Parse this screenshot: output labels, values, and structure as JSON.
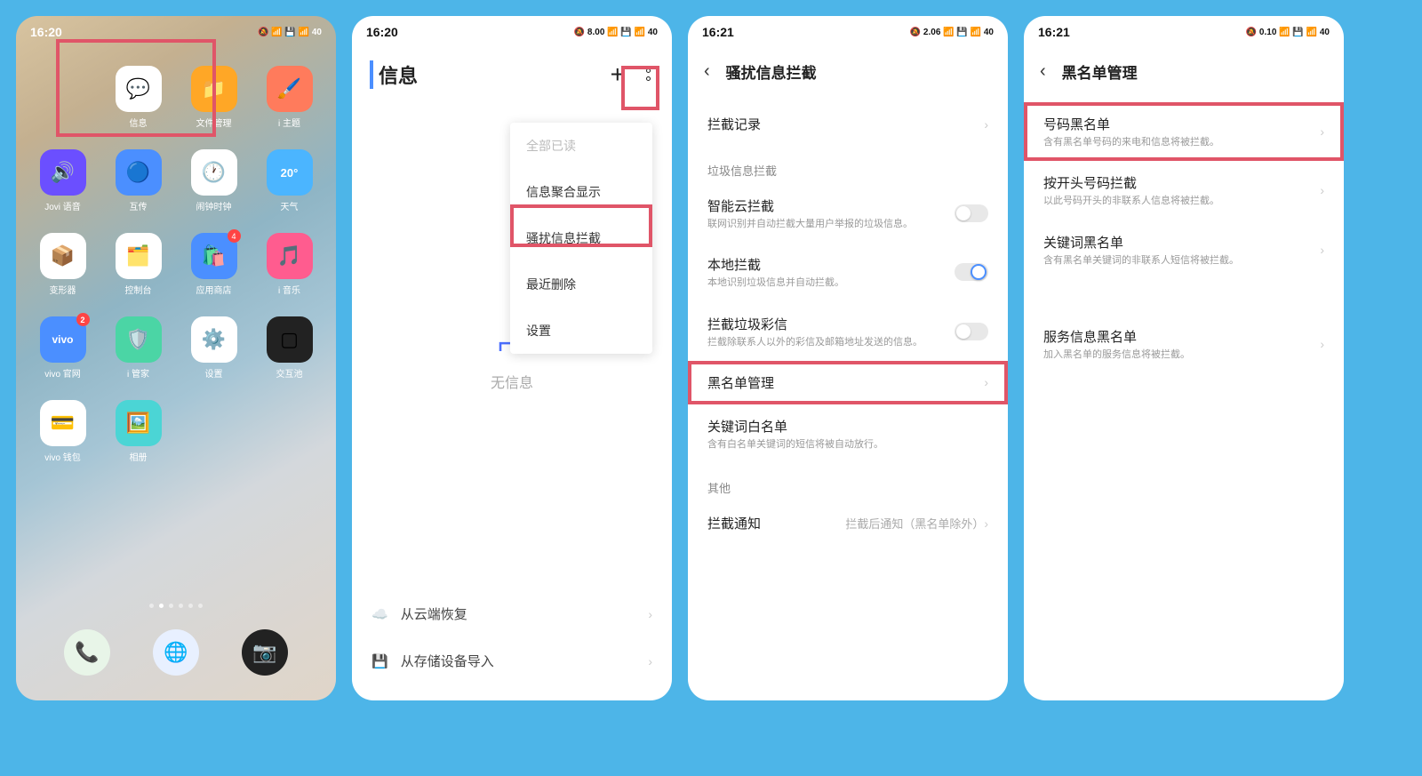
{
  "screen1": {
    "time": "16:20",
    "status": "🔕 📶 💾 📶 40",
    "apps": [
      {
        "label": "信息",
        "color": "#ffffff",
        "emoji": "💬",
        "offset": 0
      },
      {
        "label": "文件管理",
        "color": "#ffa726",
        "emoji": "📁"
      },
      {
        "label": "i 主题",
        "color": "#ff7b5c",
        "emoji": "🖌️"
      },
      {
        "label": "Jovi 语音",
        "color": "#6b4fff",
        "emoji": "🔊"
      },
      {
        "label": "互传",
        "color": "#4b8fff",
        "emoji": "🔵"
      },
      {
        "label": "闹钟时钟",
        "color": "#ffffff",
        "emoji": "🕐"
      },
      {
        "label": "天气",
        "color": "#4bb5ff",
        "emoji": "☁️",
        "text": "20°"
      },
      {
        "label": "变形器",
        "color": "#ffffff",
        "emoji": "📦"
      },
      {
        "label": "控制台",
        "color": "#ffffff",
        "emoji": "🗂️"
      },
      {
        "label": "应用商店",
        "color": "#4b8fff",
        "emoji": "🛍️",
        "badge": "4"
      },
      {
        "label": "i 音乐",
        "color": "#ff5c8f",
        "emoji": "🎵"
      },
      {
        "label": "vivo 官网",
        "color": "#4b8fff",
        "emoji": "vivo",
        "badge": "2"
      },
      {
        "label": "i 管家",
        "color": "#4bd5a5",
        "emoji": "🛡️"
      },
      {
        "label": "设置",
        "color": "#ffffff",
        "emoji": "⚙️"
      },
      {
        "label": "交互池",
        "color": "#222222",
        "emoji": "▢"
      },
      {
        "label": "vivo 钱包",
        "color": "#ffffff",
        "emoji": "💳"
      },
      {
        "label": "相册",
        "color": "#4bd5d5",
        "emoji": "🖼️"
      }
    ]
  },
  "screen2": {
    "time": "16:20",
    "status": "🔕 8.00 📶 💾 📶 40",
    "title": "信息",
    "menu": [
      "全部已读",
      "信息聚合显示",
      "骚扰信息拦截",
      "最近删除",
      "设置"
    ],
    "empty": "无信息",
    "bottom": [
      {
        "icon": "☁️",
        "label": "从云端恢复"
      },
      {
        "icon": "💾",
        "label": "从存储设备导入"
      }
    ]
  },
  "screen3": {
    "time": "16:21",
    "status": "🔕 2.06 📶 💾 📶 40",
    "title": "骚扰信息拦截",
    "items": [
      {
        "title": "拦截记录",
        "type": "nav"
      },
      {
        "title": "垃圾信息拦截",
        "type": "section"
      },
      {
        "title": "智能云拦截",
        "subtitle": "联网识别并自动拦截大量用户举报的垃圾信息。",
        "type": "toggle",
        "on": false
      },
      {
        "title": "本地拦截",
        "subtitle": "本地识别垃圾信息并自动拦截。",
        "type": "toggle",
        "on": true
      },
      {
        "title": "拦截垃圾彩信",
        "subtitle": "拦截除联系人以外的彩信及邮箱地址发送的信息。",
        "type": "toggle",
        "on": false
      },
      {
        "title": "黑名单管理",
        "type": "nav",
        "highlight": true
      },
      {
        "title": "关键词白名单",
        "subtitle": "含有白名单关键词的短信将被自动放行。",
        "type": "plain"
      },
      {
        "title": "其他",
        "type": "section"
      },
      {
        "title": "拦截通知",
        "value": "拦截后通知（黑名单除外）",
        "type": "nav"
      }
    ]
  },
  "screen4": {
    "time": "16:21",
    "status": "🔕 0.10 📶 💾 📶 40",
    "title": "黑名单管理",
    "items": [
      {
        "title": "号码黑名单",
        "subtitle": "含有黑名单号码的来电和信息将被拦截。",
        "type": "nav",
        "highlight": true
      },
      {
        "title": "按开头号码拦截",
        "subtitle": "以此号码开头的非联系人信息将被拦截。",
        "type": "nav"
      },
      {
        "title": "关键词黑名单",
        "subtitle": "含有黑名单关键词的非联系人短信将被拦截。",
        "type": "nav"
      },
      {
        "title": "服务信息黑名单",
        "subtitle": "加入黑名单的服务信息将被拦截。",
        "type": "nav",
        "spacer": true
      }
    ]
  }
}
